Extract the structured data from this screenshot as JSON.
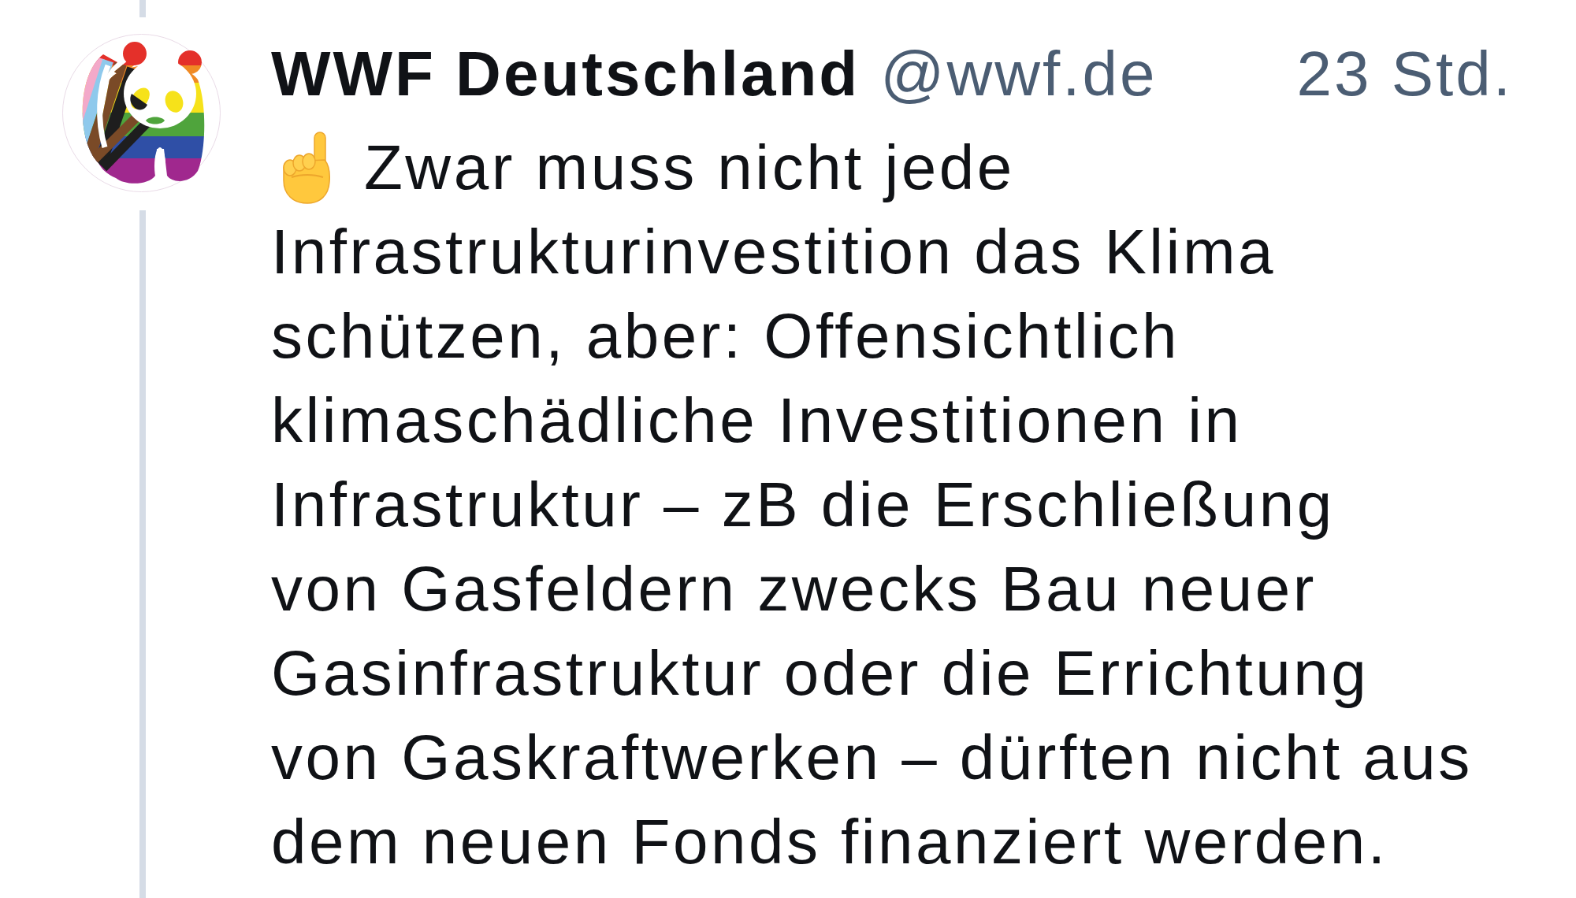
{
  "post": {
    "author": {
      "name": "WWF Deutschland",
      "handle": "@wwf.de"
    },
    "time": "23 Std.",
    "text_lines": [
      "Zwar muss nicht jede",
      "Infrastrukturinvestition das Klima",
      "schützen, aber: Offensichtlich",
      "klimaschädliche Investitionen in",
      "Infrastruktur – zB die Erschließung",
      "von Gasfeldern zwecks Bau neuer",
      "Gasinfrastruktur oder die Errichtung",
      "von Gaskraftwerken – dürften nicht aus",
      "dem neuen Fonds finanziert werden."
    ]
  }
}
